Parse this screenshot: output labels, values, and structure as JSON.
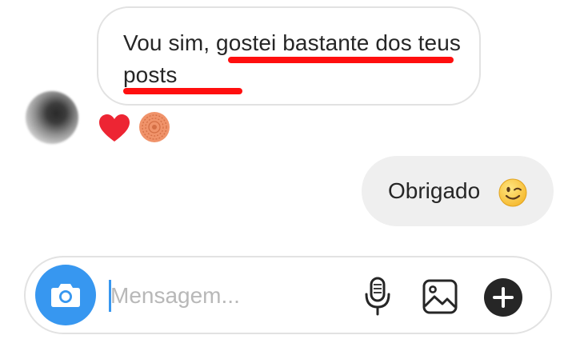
{
  "thread": {
    "incoming_message": {
      "text": "Vou sim, gostei bastante dos teus posts",
      "reactions": [
        "heart-icon",
        "sticker-icon"
      ],
      "underline_color": "#ff0f0f"
    },
    "outgoing_message": {
      "text": "Obrigado",
      "emoji": "winking-face-icon"
    }
  },
  "composer": {
    "placeholder": "Mensagem...",
    "value": "",
    "accent_color": "#3797f0",
    "buttons": [
      "camera-icon",
      "microphone-icon",
      "image-icon",
      "plus-icon"
    ]
  },
  "colors": {
    "heart": "#ed2533",
    "sticker": "#f0936a",
    "outgoing_bubble": "#efefef",
    "bubble_border": "#e2e2e2"
  }
}
